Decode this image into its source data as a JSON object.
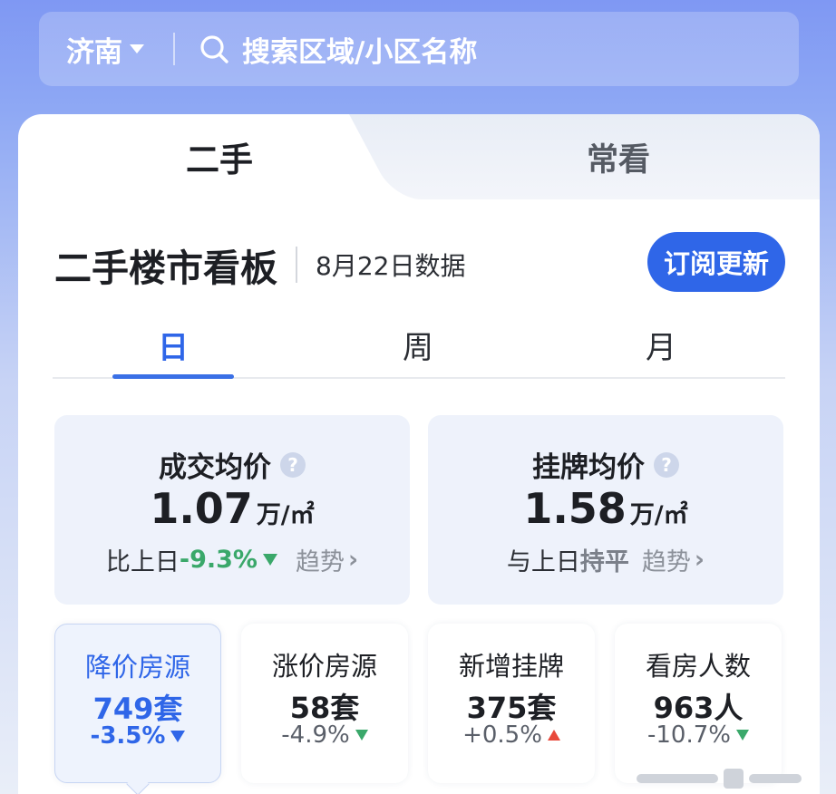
{
  "search": {
    "city": "济南",
    "placeholder": "搜索区域/小区名称"
  },
  "top_tabs": [
    {
      "label": "二手",
      "active": true
    },
    {
      "label": "常看",
      "active": false
    }
  ],
  "board": {
    "title": "二手楼市看板",
    "date_note": "8月22日数据",
    "subscribe_label": "订阅更新"
  },
  "period_tabs": [
    {
      "label": "日",
      "active": true
    },
    {
      "label": "周",
      "active": false
    },
    {
      "label": "月",
      "active": false
    }
  ],
  "price_cards": [
    {
      "label": "成交均价",
      "value": "1.07",
      "unit": "万/㎡",
      "compare_prefix": "比上日",
      "change": "-9.3%",
      "trend_label": "趋势"
    },
    {
      "label": "挂牌均价",
      "value": "1.58",
      "unit": "万/㎡",
      "compare_prefix": "与上日",
      "change": "持平",
      "trend_label": "趋势"
    }
  ],
  "stats": [
    {
      "label": "降价房源",
      "value": "749套",
      "change": "-3.5%",
      "direction": "down",
      "active": true
    },
    {
      "label": "涨价房源",
      "value": "58套",
      "change": "-4.9%",
      "direction": "down",
      "active": false
    },
    {
      "label": "新增挂牌",
      "value": "375套",
      "change": "+0.5%",
      "direction": "up",
      "active": false
    },
    {
      "label": "看房人数",
      "value": "963人",
      "change": "-10.7%",
      "direction": "down",
      "active": false
    }
  ],
  "colors": {
    "accent": "#2f66e8",
    "down_green": "#3aa86a",
    "up_red": "#e8493b",
    "card_bg": "#eef2fb"
  }
}
